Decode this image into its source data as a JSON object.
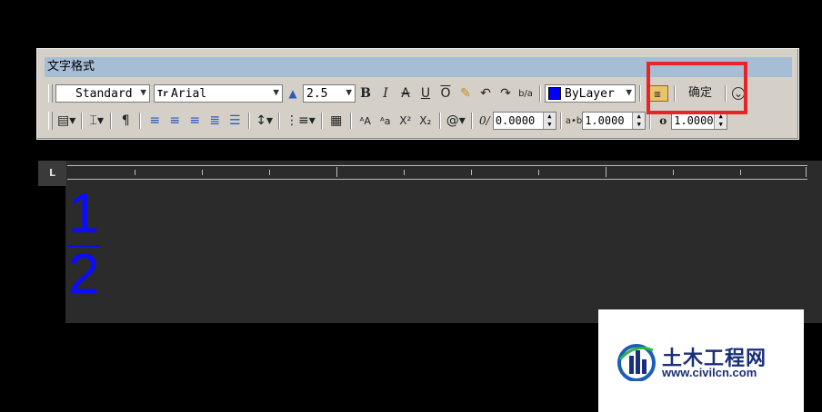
{
  "window": {
    "title": "文字格式"
  },
  "row1": {
    "style_value": "Standard",
    "font_value": "Arial",
    "font_prefix": "Tr",
    "height_value": "2.5",
    "bold": "B",
    "italic": "I",
    "strike": "A",
    "underline": "U",
    "overline": "O",
    "stack": "b/a",
    "color_value": "ByLayer",
    "ok_label": "确定"
  },
  "row2": {
    "oblique_value": "0.0000",
    "tracking_value": "1.0000",
    "width_value": "1.0000",
    "at_symbol": "@",
    "oblique_icon": "0/",
    "tracking_icon": "a•b",
    "width_icon": "o"
  },
  "ruler": {
    "corner": "L"
  },
  "editor": {
    "numerator": "1",
    "denominator": "2"
  },
  "watermark": {
    "name": "土木工程网",
    "url": "www.civilcn.com"
  },
  "colors": {
    "fraction": "#0b0bff",
    "highlight": "#e8232a",
    "titlebar": "#a6bdd6"
  }
}
